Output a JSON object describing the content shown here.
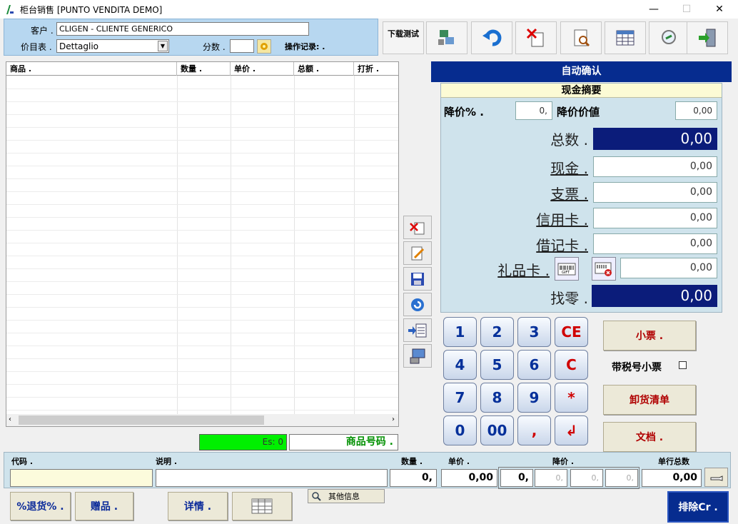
{
  "window": {
    "title": "柜台销售 [PUNTO VENDITA DEMO]",
    "minimize": "—",
    "maximize": "☐",
    "close": "✕"
  },
  "customer": {
    "label": "客户 .",
    "value": "CLIGEN - CLIENTE GENERICO",
    "pricelist_label": "价目表 .",
    "pricelist_value": "Dettaglio",
    "points_label": "分数 .",
    "points_value": "",
    "oplog_label": "操作记录: ."
  },
  "toolbar": {
    "download_test": "下载测试",
    "icons": [
      "network-icon",
      "undo-icon",
      "cancel-document-icon",
      "preview-icon",
      "table-icon",
      "magnifier-icon",
      "exit-icon"
    ]
  },
  "grid": {
    "columns": [
      "商品 .",
      "数量 .",
      "单价 .",
      "总额 .",
      "打折 ."
    ],
    "rows": []
  },
  "summary": {
    "auto_confirm": "自动确认",
    "cash_summary": "现金摘要",
    "discount_pct_label": "降价% .",
    "discount_pct_value": "0,",
    "discount_value_label": "降价价値",
    "discount_value": "0,00",
    "total_label": "总数 .",
    "total_value": "0,00",
    "cash_label": "现金 .",
    "cash_value": "0,00",
    "check_label": "支票 .",
    "check_value": "0,00",
    "credit_label": "信用卡 .",
    "credit_value": "0,00",
    "debit_label": "借记卡 .",
    "debit_value": "0,00",
    "gift_label": "礼品卡 .",
    "gift_value": "0,00",
    "change_label": "找零 .",
    "change_value": "0,00"
  },
  "keypad": {
    "keys": [
      "1",
      "2",
      "3",
      "CE",
      "4",
      "5",
      "6",
      "C",
      "7",
      "8",
      "9",
      "*",
      "0",
      "00",
      ",",
      "↲"
    ]
  },
  "actions": {
    "receipt": "小票 .",
    "tax_receipt": "带税号小票",
    "delivery_note": "卸货清单",
    "document": "文档 ."
  },
  "status": {
    "es": "Es:  0",
    "item_code": "商品号码 ."
  },
  "entry": {
    "code_label": "代码 .",
    "code_value": "",
    "desc_label": "说明 .",
    "desc_value": "",
    "qty_label": "数量 .",
    "qty_value": "0,",
    "price_label": "单价 .",
    "price_value": "0,00",
    "discount_label": "降价 .",
    "discount_value": "0,",
    "disc2": "0,",
    "disc3": "0,",
    "disc4": "0,",
    "rowtotal_label": "单行总数",
    "rowtotal_value": "0,00"
  },
  "bottom": {
    "return_pct": "%退货% .",
    "gift": "赠品 .",
    "details": "详情 .",
    "other_info": "其他信息",
    "exclude": "排除Cr ."
  }
}
